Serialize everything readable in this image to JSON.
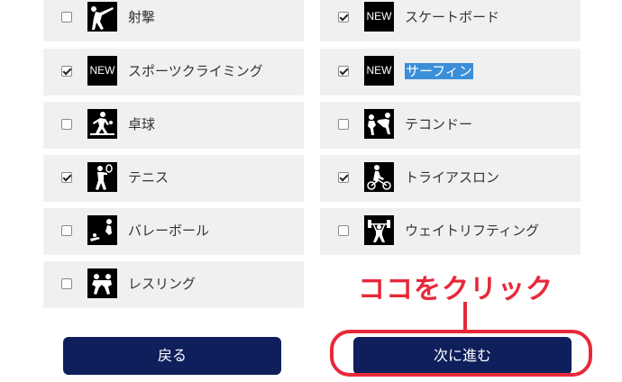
{
  "sports": {
    "left": [
      {
        "label": "射撃",
        "checked": false,
        "icon": "shooting-icon"
      },
      {
        "label": "スポーツクライミング",
        "checked": true,
        "icon": "new-badge-icon",
        "badge": "NEW"
      },
      {
        "label": "卓球",
        "checked": false,
        "icon": "table-tennis-icon"
      },
      {
        "label": "テニス",
        "checked": true,
        "icon": "tennis-icon"
      },
      {
        "label": "バレーボール",
        "checked": false,
        "icon": "volleyball-icon"
      },
      {
        "label": "レスリング",
        "checked": false,
        "icon": "wrestling-icon"
      }
    ],
    "right": [
      {
        "label": "スケートボード",
        "checked": true,
        "icon": "new-badge-icon",
        "badge": "NEW"
      },
      {
        "label": "サーフィン",
        "checked": true,
        "icon": "new-badge-icon",
        "badge": "NEW",
        "text_selected": true
      },
      {
        "label": "テコンドー",
        "checked": false,
        "icon": "taekwondo-icon"
      },
      {
        "label": "トライアスロン",
        "checked": true,
        "icon": "triathlon-icon"
      },
      {
        "label": "ウェイトリフティング",
        "checked": false,
        "icon": "weightlifting-icon"
      }
    ]
  },
  "buttons": {
    "back_label": "戻る",
    "next_label": "次に進む"
  },
  "annotation": {
    "text": "ココをクリック",
    "color": "#e8283a"
  },
  "colors": {
    "button_bg": "#0f1f5c",
    "row_bg": "#f0f0f0",
    "selection": "#3b8fd9"
  }
}
